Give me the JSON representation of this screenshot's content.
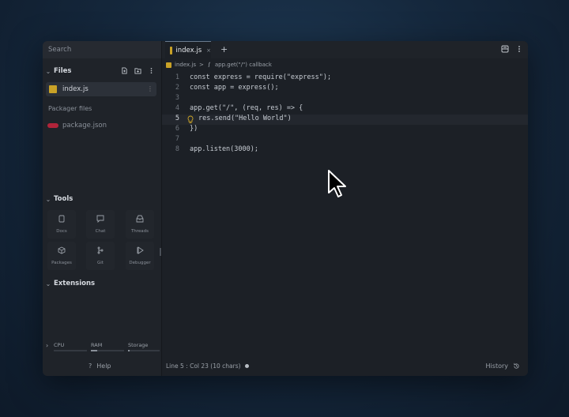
{
  "sidebar": {
    "search_placeholder": "Search",
    "files_title": "Files",
    "files": [
      {
        "name": "index.js",
        "active": true
      }
    ],
    "packager_label": "Packager files",
    "packager_files": [
      {
        "name": "package.json"
      }
    ],
    "tools_title": "Tools",
    "tools": [
      {
        "label": "Docs",
        "icon": "book-icon"
      },
      {
        "label": "Chat",
        "icon": "chat-icon"
      },
      {
        "label": "Threads",
        "icon": "inbox-icon"
      },
      {
        "label": "Packages",
        "icon": "cube-icon"
      },
      {
        "label": "Git",
        "icon": "git-icon"
      },
      {
        "label": "Debugger",
        "icon": "debugger-icon"
      }
    ],
    "extensions_title": "Extensions",
    "resources": {
      "cpu": "CPU",
      "ram": "RAM",
      "storage": "Storage"
    },
    "resource_levels": {
      "cpu": 0.0,
      "ram": 0.18,
      "storage": 0.05
    },
    "help": "Help"
  },
  "editor": {
    "tab": {
      "name": "index.js",
      "close": "×"
    },
    "add_tab": "+",
    "breadcrumb": {
      "file": "index.js",
      "sep": ">",
      "symbol": "app.get(\"/\") callback"
    },
    "lines": [
      {
        "n": "1",
        "code": "const express = require(\"express\");"
      },
      {
        "n": "2",
        "code": "const app = express();"
      },
      {
        "n": "3",
        "code": ""
      },
      {
        "n": "4",
        "code": "app.get(\"/\", (req, res) => {"
      },
      {
        "n": "5",
        "code": "res.send(\"Hello World\")",
        "current": true
      },
      {
        "n": "6",
        "code": "})"
      },
      {
        "n": "7",
        "code": ""
      },
      {
        "n": "8",
        "code": "app.listen(3000);"
      }
    ],
    "status": "Line 5 : Col 23 (10 chars)",
    "history": "History"
  },
  "colors": {
    "accent_js": "#c9a227",
    "json": "#b0243a",
    "background": "#15283d"
  }
}
